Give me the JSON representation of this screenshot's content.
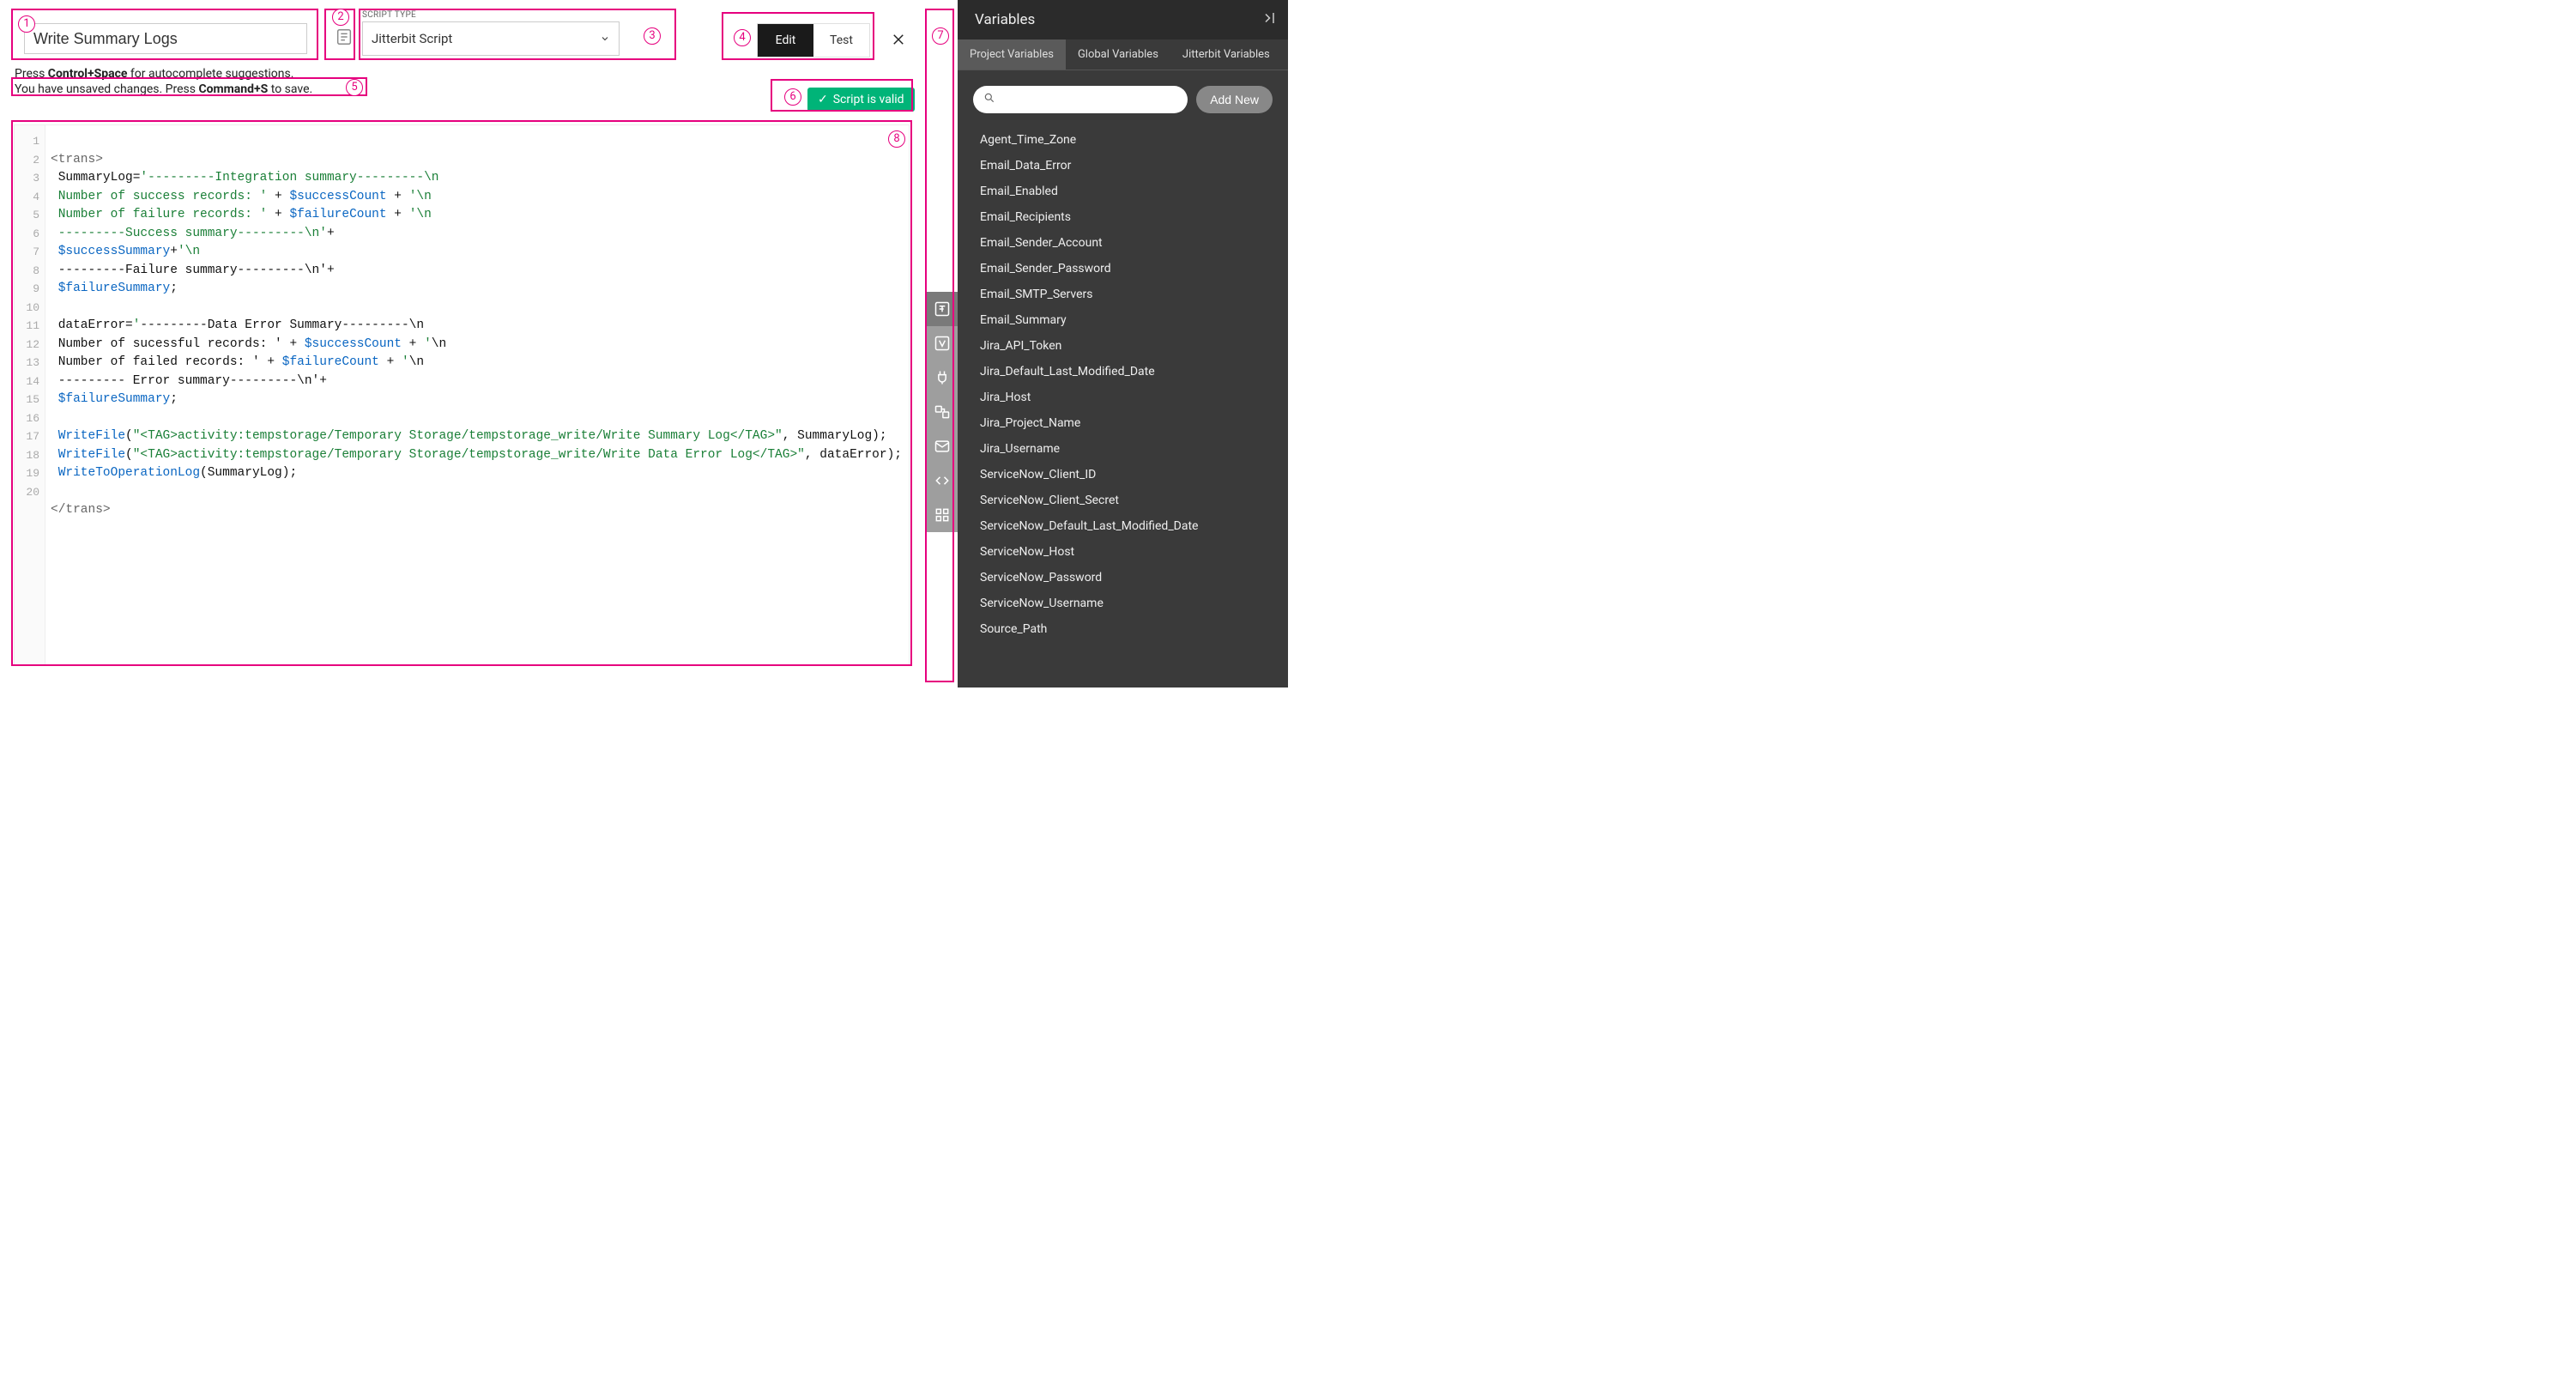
{
  "name": "Write Summary Logs",
  "scriptTypeLabel": "SCRIPT TYPE",
  "scriptType": "Jitterbit Script",
  "mode": {
    "edit": "Edit",
    "test": "Test"
  },
  "hint1a": "Press ",
  "hint1b": "Control+Space",
  "hint1c": " for autocomplete suggestions.",
  "hint2a": "You have unsaved changes. Press ",
  "hint2b": "Command+S",
  "hint2c": " to save.",
  "validLabel": "Script is valid",
  "lines": {
    "l1": "<trans>",
    "l2a": " SummaryLog=",
    "l2b": "'---------Integration summary---------\\n",
    "l3a": " Number of success records: '",
    "l3b": " + ",
    "l3c": "$successCount",
    "l3d": " + ",
    "l3e": "'\\n",
    "l4a": " Number of failure records: '",
    "l4b": " + ",
    "l4c": "$failureCount",
    "l4d": " + ",
    "l4e": "'\\n",
    "l5a": " ---------Success summary---------\\n'",
    "l5b": "+",
    "l6a": " $successSummary",
    "l6b": "+",
    "l6c": "'\\n",
    "l7a": " ---------Failure summary---------\\n'",
    "l7b": "+",
    "l8a": " $failureSummary",
    "l8b": ";",
    "l10a": " dataError=",
    "l10b": "'",
    "l10c": "---------Data Error Summary---------\\n",
    "l11a": " Number of sucessful records: '",
    "l11b": " + ",
    "l11c": "$successCount",
    "l11d": " + ",
    "l11e": "'",
    "l11f": "\\n",
    "l12a": " Number of failed records: '",
    "l12b": " + ",
    "l12c": "$failureCount",
    "l12d": " + ",
    "l12e": "'",
    "l12f": "\\n",
    "l13a": " --------- Error summary---------\\n'",
    "l13b": "+",
    "l14a": " $failureSummary",
    "l14b": ";",
    "l16a": " WriteFile",
    "l16b": "(",
    "l16c": "\"<TAG>activity:tempstorage/Temporary Storage/tempstorage_write/Write Summary Log</TAG>\"",
    "l16d": ", SummaryLog);",
    "l17a": " WriteFile",
    "l17b": "(",
    "l17c": "\"<TAG>activity:tempstorage/Temporary Storage/tempstorage_write/Write Data Error Log</TAG>\"",
    "l17d": ", dataError);",
    "l18a": " WriteToOperationLog",
    "l18b": "(SummaryLog);",
    "l20": "</trans>"
  },
  "sidepanel": {
    "title": "Variables",
    "tabs": [
      "Project Variables",
      "Global Variables",
      "Jitterbit Variables"
    ],
    "addNew": "Add New",
    "items": [
      "Agent_Time_Zone",
      "Email_Data_Error",
      "Email_Enabled",
      "Email_Recipients",
      "Email_Sender_Account",
      "Email_Sender_Password",
      "Email_SMTP_Servers",
      "Email_Summary",
      "Jira_API_Token",
      "Jira_Default_Last_Modified_Date",
      "Jira_Host",
      "Jira_Project_Name",
      "Jira_Username",
      "ServiceNow_Client_ID",
      "ServiceNow_Client_Secret",
      "ServiceNow_Default_Last_Modified_Date",
      "ServiceNow_Host",
      "ServiceNow_Password",
      "ServiceNow_Username",
      "Source_Path"
    ]
  },
  "annotations": [
    "1",
    "2",
    "3",
    "4",
    "5",
    "6",
    "7",
    "8"
  ]
}
